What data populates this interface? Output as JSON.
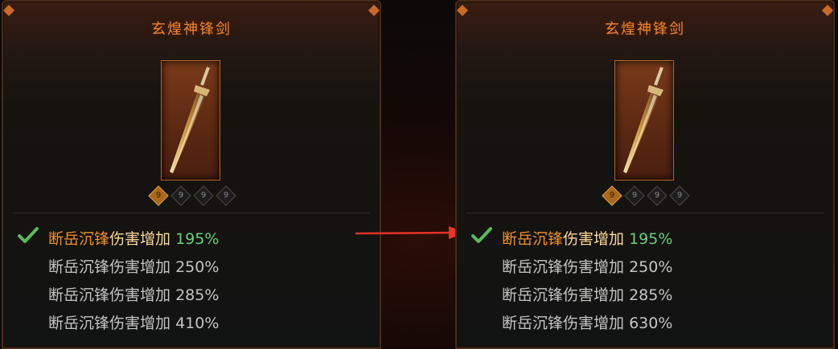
{
  "left_panel": {
    "title": "玄煌神锋剑",
    "sockets": [
      "9",
      "9",
      "9",
      "9"
    ],
    "affixes": [
      {
        "name": "断岳沉锋",
        "suffix": "伤害增加",
        "value": "195%"
      },
      {
        "name": "断岳沉锋",
        "suffix": "伤害增加",
        "value": "250%"
      },
      {
        "name": "断岳沉锋",
        "suffix": "伤害增加",
        "value": "285%"
      },
      {
        "name": "断岳沉锋",
        "suffix": "伤害增加",
        "value": "410%"
      }
    ]
  },
  "right_panel": {
    "title": "玄煌神锋剑",
    "sockets": [
      "9",
      "9",
      "9",
      "9"
    ],
    "affixes": [
      {
        "name": "断岳沉锋",
        "suffix": "伤害增加",
        "value": "195%"
      },
      {
        "name": "断岳沉锋",
        "suffix": "伤害增加",
        "value": "250%"
      },
      {
        "name": "断岳沉锋",
        "suffix": "伤害增加",
        "value": "285%"
      },
      {
        "name": "断岳沉锋",
        "suffix": "伤害增加",
        "value": "630%"
      }
    ]
  },
  "colors": {
    "title": "#f08436",
    "active_name": "#f09030",
    "active_value": "#6ad07a",
    "inactive_text": "#c4c4c4",
    "arrow": "#e8322a"
  },
  "icons": {
    "check": "checkmark-icon",
    "arrow": "arrow-right-icon",
    "socket": "gem-socket-icon"
  }
}
